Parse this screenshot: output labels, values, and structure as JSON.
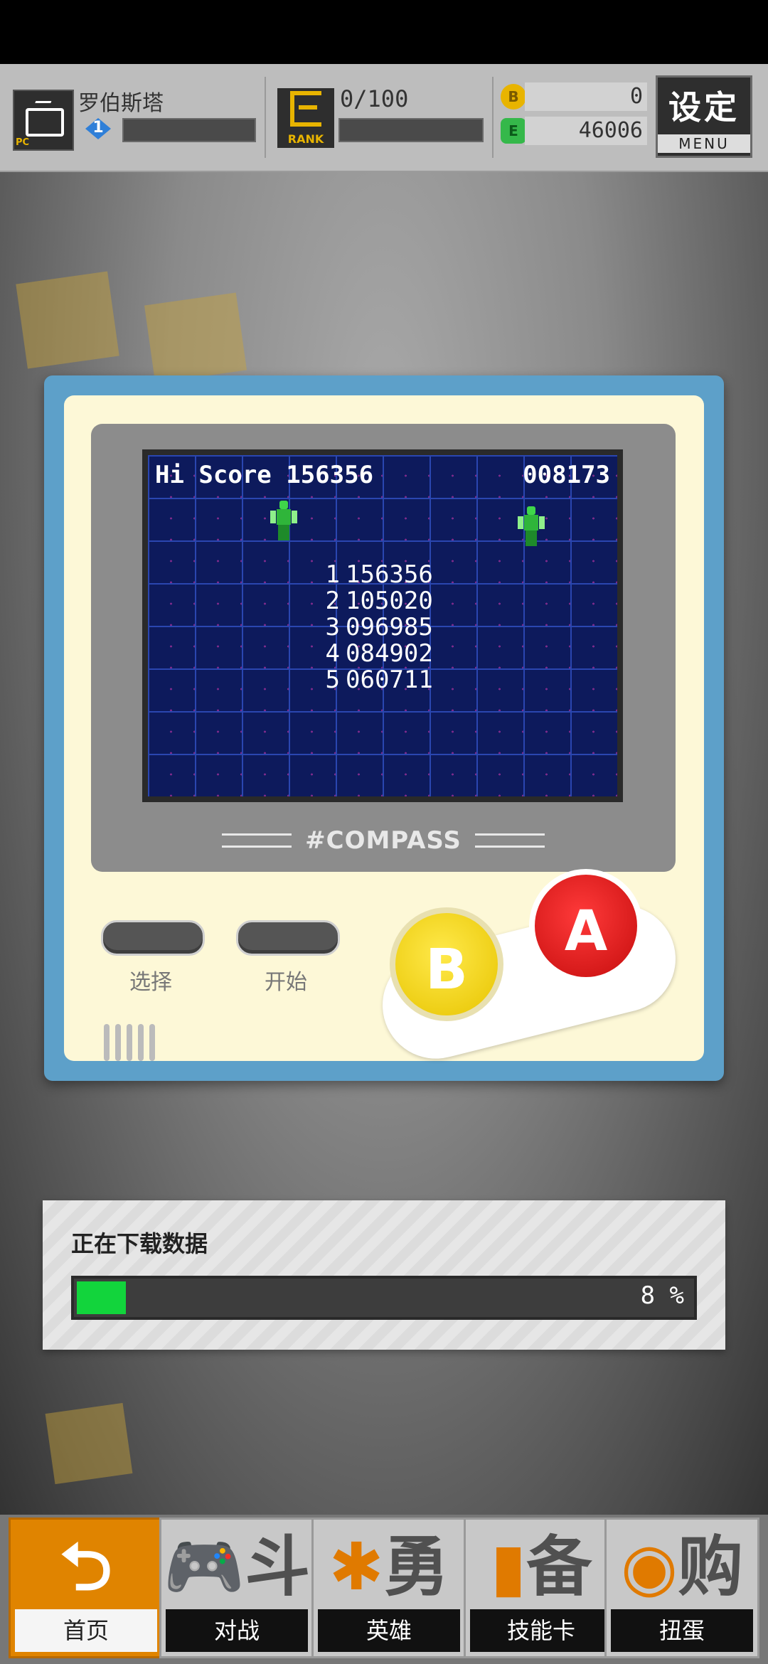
{
  "player": {
    "name": "罗伯斯塔",
    "level": "1",
    "tag": "PC"
  },
  "rank": {
    "label": "RANK",
    "progress": "0/100"
  },
  "currency": {
    "coins": "0",
    "energy": "46006",
    "coin_symbol": "B",
    "energy_symbol": "E"
  },
  "menu": {
    "title": "设定",
    "subtitle": "MENU"
  },
  "game": {
    "hi_score_label": "Hi Score 156356",
    "current_score": "008173",
    "high_scores": [
      {
        "rank": "1",
        "score": "156356"
      },
      {
        "rank": "2",
        "score": "105020"
      },
      {
        "rank": "3",
        "score": "096985"
      },
      {
        "rank": "4",
        "score": "084902"
      },
      {
        "rank": "5",
        "score": "060711"
      }
    ],
    "brand": "#COMPASS"
  },
  "controls": {
    "select": "选择",
    "start": "开始",
    "b": "B",
    "a": "A"
  },
  "download": {
    "label": "正在下载数据",
    "progress_percent": 8,
    "progress_text": "8 %"
  },
  "nav": {
    "tabs": [
      {
        "glyph": "⮌",
        "label": "首页",
        "active": true
      },
      {
        "glyph": "斗",
        "label": "对战",
        "active": false
      },
      {
        "glyph": "勇",
        "label": "英雄",
        "active": false
      },
      {
        "glyph": "备",
        "label": "技能卡",
        "active": false
      },
      {
        "glyph": "购",
        "label": "扭蛋",
        "active": false
      }
    ]
  },
  "colors": {
    "accent": "#e08400",
    "progress": "#12d43c",
    "screen_bg": "#0d1a5c",
    "frame": "#5da0c9"
  },
  "icons": {
    "player": "tv-icon",
    "rank": "rank-badge-icon",
    "coin": "coin-icon",
    "energy": "energy-icon",
    "home": "return-arrow-icon",
    "battle": "gamepad-icon",
    "hero": "hero-icon",
    "card": "card-icon",
    "gacha": "gacha-icon"
  }
}
